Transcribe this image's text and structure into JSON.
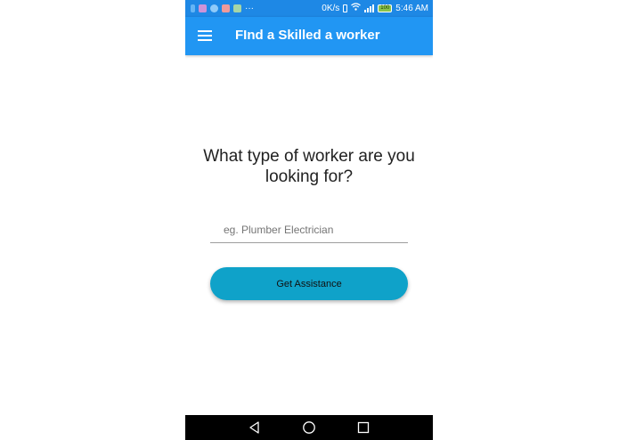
{
  "status_bar": {
    "network_speed": "0K/s",
    "battery_level": "100",
    "time": "5:46 AM",
    "more_notifications": "···",
    "notification_icons": [
      "bluetooth-icon",
      "app-notification-icon",
      "app-notification-icon",
      "app-notification-icon",
      "app-notification-icon"
    ]
  },
  "app_bar": {
    "title": "FInd a Skilled a worker",
    "menu_icon": "hamburger-menu-icon"
  },
  "main": {
    "question": "What type of worker are you looking for?",
    "search_placeholder": "eg. Plumber Electrician",
    "search_value": "",
    "submit_label": "Get Assistance"
  },
  "nav_bar": {
    "icons": [
      "back-icon",
      "home-icon",
      "recents-icon"
    ]
  },
  "colors": {
    "status_bar": "#1e88e5",
    "app_bar": "#2196f3",
    "button": "#0fa2c9",
    "nav_bar": "#000000"
  }
}
